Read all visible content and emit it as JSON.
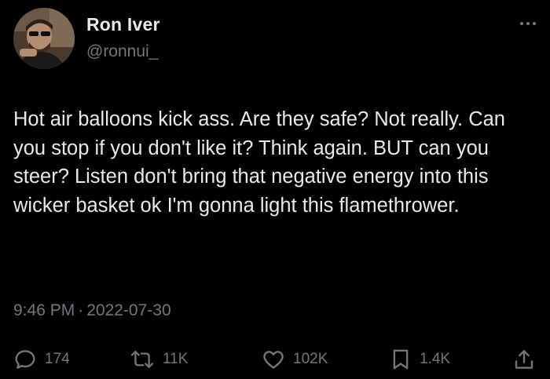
{
  "author": {
    "display_name": "Ron Iver",
    "handle": "@ronnui_",
    "avatar_icon": "profile-photo"
  },
  "tweet": {
    "text": "Hot air balloons kick ass. Are they safe? Not really. Can you stop if you don't like it? Think again. BUT can you steer? Listen don't bring that negative energy into this wicker basket ok I'm gonna light this flamethrower.",
    "time": "9:46 PM",
    "separator": "·",
    "date": "2022-07-30"
  },
  "actions": {
    "reply": {
      "icon": "reply-icon",
      "count": "174"
    },
    "retweet": {
      "icon": "retweet-icon",
      "count": "11K"
    },
    "like": {
      "icon": "heart-icon",
      "count": "102K"
    },
    "bookmark": {
      "icon": "bookmark-icon",
      "count": "1.4K"
    },
    "share": {
      "icon": "share-icon"
    }
  },
  "colors": {
    "background": "#000000",
    "primary_text": "#e7e9ea",
    "secondary_text": "#71767b"
  }
}
